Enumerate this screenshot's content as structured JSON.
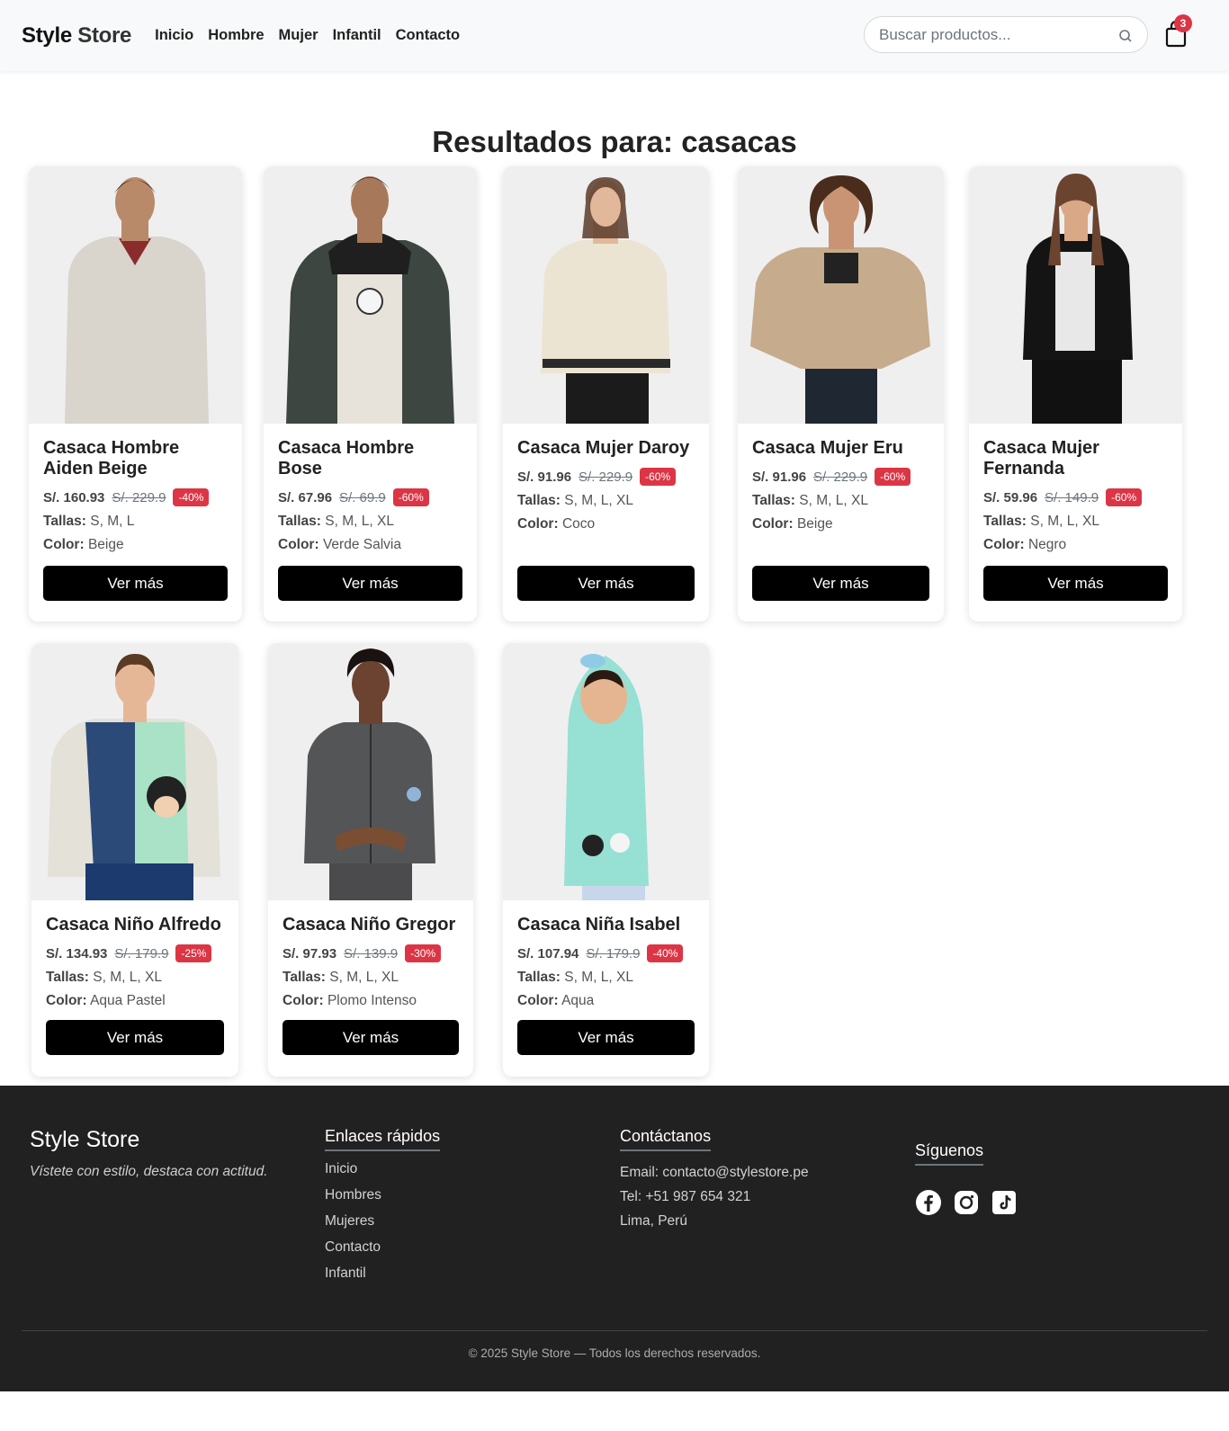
{
  "header": {
    "brand_part1": "Style",
    "brand_part2": "Store",
    "nav": [
      "Inicio",
      "Hombre",
      "Mujer",
      "Infantil",
      "Contacto"
    ],
    "search_placeholder": "Buscar productos...",
    "cart_count": "3"
  },
  "main": {
    "title": "Resultados para: casacas"
  },
  "labels": {
    "sizes": "Tallas:",
    "color": "Color:",
    "button": "Ver más"
  },
  "products": [
    {
      "name": "Casaca Hombre Aiden Beige",
      "price": "S/. 160.93",
      "old_price": "S/. 229.9",
      "discount": "-40%",
      "sizes": "S, M, L",
      "color": "Beige"
    },
    {
      "name": "Casaca Hombre Bose",
      "price": "S/. 67.96",
      "old_price": "S/. 69.9",
      "discount": "-60%",
      "sizes": "S, M, L, XL",
      "color": "Verde Salvia"
    },
    {
      "name": "Casaca Mujer Daroy",
      "price": "S/. 91.96",
      "old_price": "S/. 229.9",
      "discount": "-60%",
      "sizes": "S, M, L, XL",
      "color": "Coco"
    },
    {
      "name": "Casaca Mujer Eru",
      "price": "S/. 91.96",
      "old_price": "S/. 229.9",
      "discount": "-60%",
      "sizes": "S, M, L, XL",
      "color": "Beige"
    },
    {
      "name": "Casaca Mujer Fernanda",
      "price": "S/. 59.96",
      "old_price": "S/. 149.9",
      "discount": "-60%",
      "sizes": "S, M, L, XL",
      "color": "Negro"
    },
    {
      "name": "Casaca Niño Alfredo",
      "price": "S/. 134.93",
      "old_price": "S/. 179.9",
      "discount": "-25%",
      "sizes": "S, M, L, XL",
      "color": "Aqua Pastel"
    },
    {
      "name": "Casaca Niño Gregor",
      "price": "S/. 97.93",
      "old_price": "S/. 139.9",
      "discount": "-30%",
      "sizes": "S, M, L, XL",
      "color": "Plomo Intenso"
    },
    {
      "name": "Casaca Niña Isabel",
      "price": "S/. 107.94",
      "old_price": "S/. 179.9",
      "discount": "-40%",
      "sizes": "S, M, L, XL",
      "color": "Aqua"
    }
  ],
  "footer": {
    "brand": "Style Store",
    "tagline": "Vístete con estilo, destaca con actitud.",
    "links_title": "Enlaces rápidos",
    "links": [
      "Inicio",
      "Hombres",
      "Mujeres",
      "Contacto",
      "Infantil"
    ],
    "contact_title": "Contáctanos",
    "email": "Email: contacto@stylestore.pe",
    "phone": "Tel: +51 987 654 321",
    "location": "Lima, Perú",
    "social_title": "Síguenos",
    "social_icons": [
      "facebook-icon",
      "instagram-icon",
      "tiktok-icon"
    ],
    "copyright": "© 2025 Style Store — Todos los derechos reservados."
  },
  "colors": {
    "accent": "#dc3545",
    "button": "#000000",
    "footer_bg": "#212121"
  }
}
